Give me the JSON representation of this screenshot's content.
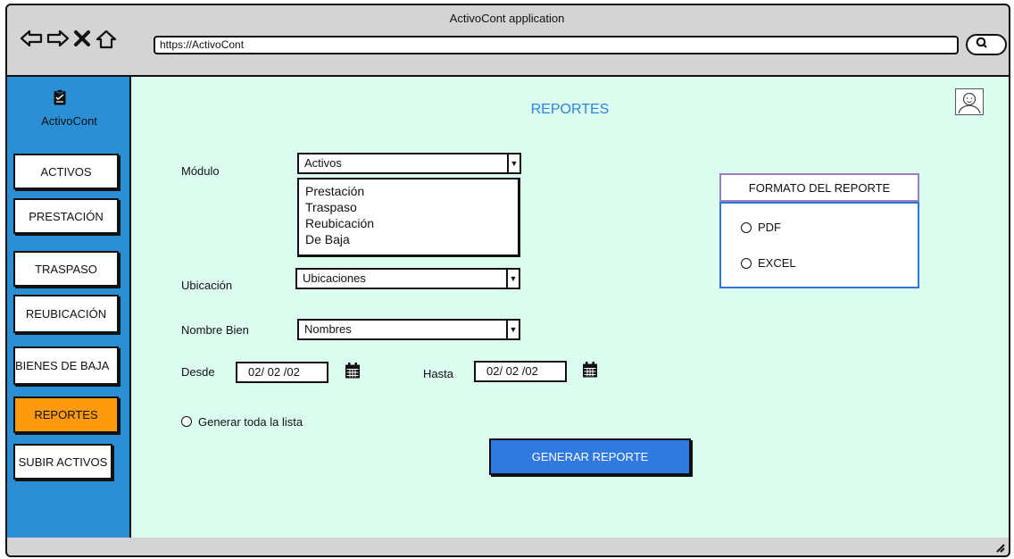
{
  "browser": {
    "title": "ActivoCont application",
    "url": "https://ActivoCont",
    "icons": [
      "back-arrow-icon",
      "forward-arrow-icon",
      "close-x-icon",
      "home-icon",
      "search-icon"
    ]
  },
  "sidebar": {
    "logo_text": "ActivoCont",
    "items": [
      {
        "label": "ACTIVOS"
      },
      {
        "label": "PRESTACIÓN"
      },
      {
        "label": "TRASPASO"
      },
      {
        "label": "REUBICACIÓN"
      },
      {
        "label": "BIENES DE BAJA"
      },
      {
        "label": "REPORTES",
        "active": true
      },
      {
        "label": "SUBIR ACTIVOS"
      }
    ]
  },
  "main": {
    "title": "REPORTES",
    "form": {
      "modulo_label": "Módulo",
      "modulo_value": "Activos",
      "modulo_options": [
        "Prestación",
        "Traspaso",
        "Reubicación",
        "De Baja"
      ],
      "ubicacion_label": "Ubicación",
      "ubicacion_value": "Ubicaciones",
      "nombre_label": "Nombre Bien",
      "nombre_value": "Nombres",
      "desde_label": "Desde",
      "desde_value": "02/ 02 /02",
      "hasta_label": "Hasta",
      "hasta_value": "02/ 02 /02",
      "generar_lista_label": "Generar toda la lista",
      "generate_button": "GENERAR REPORTE"
    },
    "format": {
      "header": "FORMATO DEL REPORTE",
      "options": [
        "PDF",
        "EXCEL"
      ]
    }
  },
  "colors": {
    "sidebar_bg": "#2b8fd6",
    "main_bg": "#dcfcef",
    "active_nav": "#ff9a0c",
    "primary_button": "#2f79e0",
    "title_color": "#2b86dd"
  }
}
